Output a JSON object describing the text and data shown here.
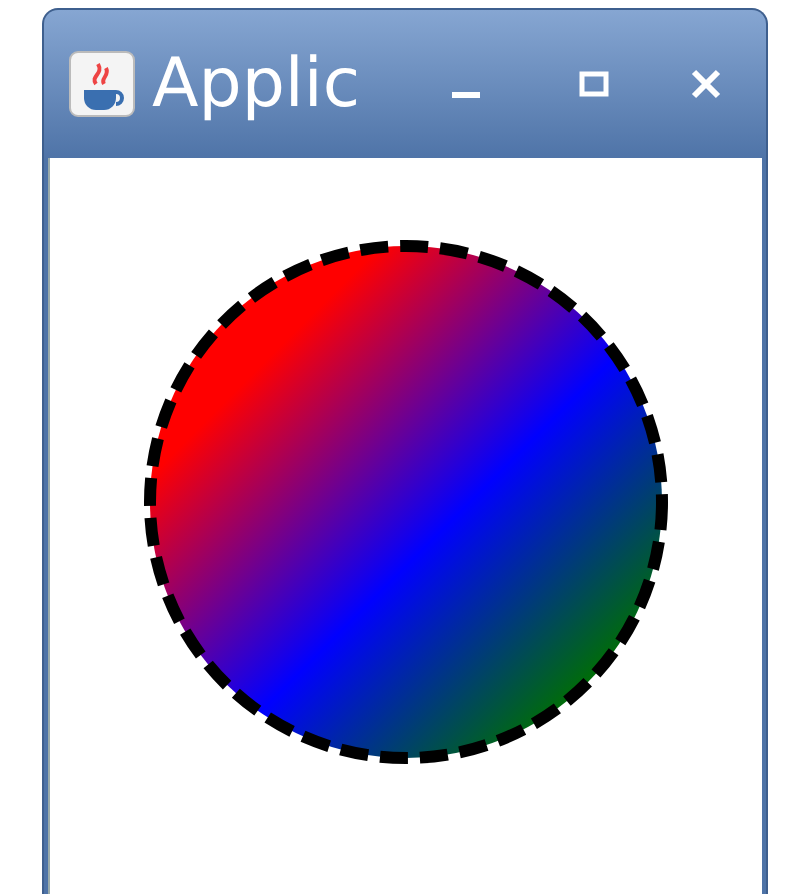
{
  "window": {
    "title": "Applic"
  },
  "canvas": {
    "kind": "circle"
  }
}
